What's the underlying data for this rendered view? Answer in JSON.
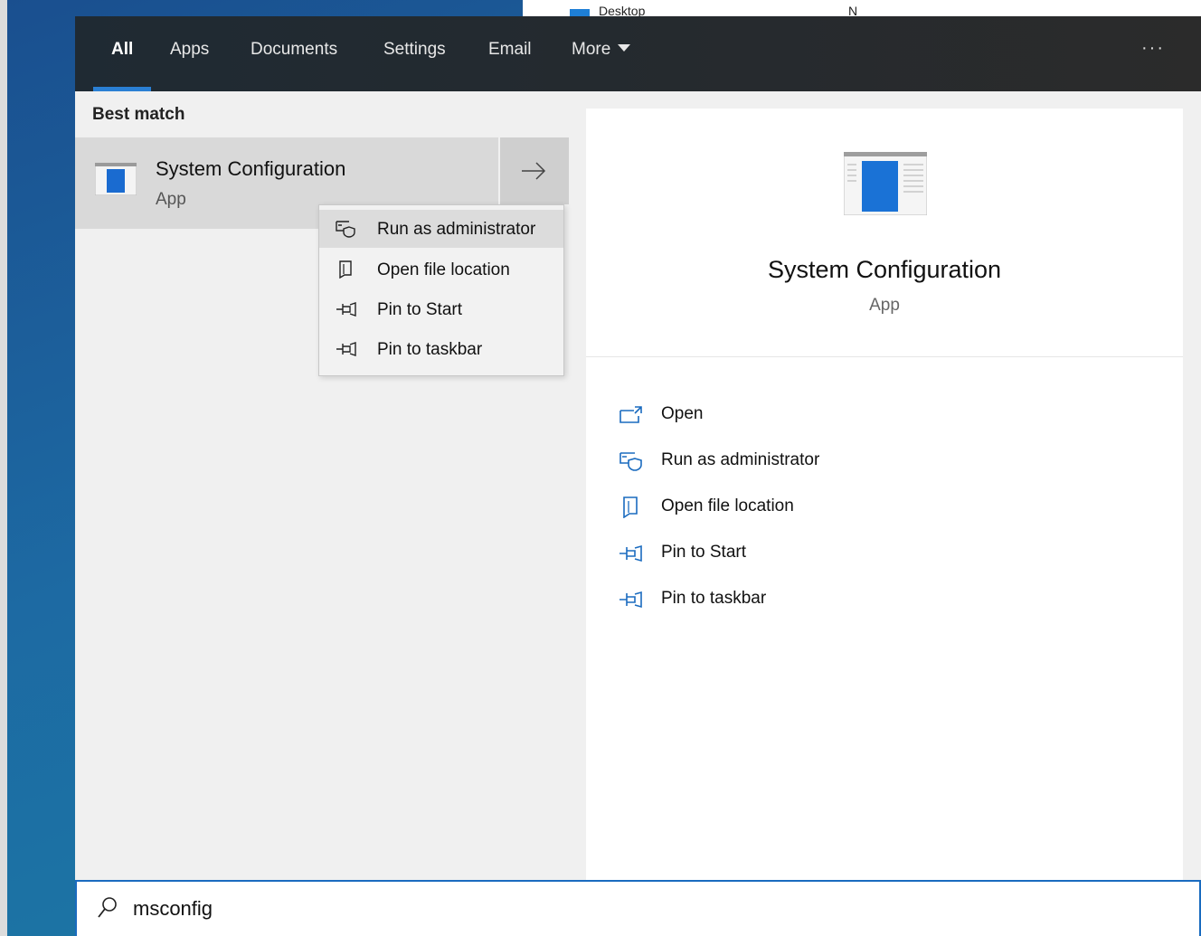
{
  "desktop": {
    "item1_label": "Desktop",
    "item2_label": "N"
  },
  "tabs": [
    {
      "label": "All",
      "active": true
    },
    {
      "label": "Apps"
    },
    {
      "label": "Documents"
    },
    {
      "label": "Settings"
    },
    {
      "label": "Email"
    },
    {
      "label": "More"
    }
  ],
  "more_options_label": "···",
  "best_match": {
    "heading": "Best match",
    "title": "System Configuration",
    "subtitle": "App"
  },
  "context_menu": [
    {
      "label": "Run as administrator",
      "icon": "shield-run-icon"
    },
    {
      "label": "Open file location",
      "icon": "file-location-icon"
    },
    {
      "label": "Pin to Start",
      "icon": "pin-icon"
    },
    {
      "label": "Pin to taskbar",
      "icon": "pin-icon"
    }
  ],
  "detail": {
    "title": "System Configuration",
    "subtitle": "App",
    "actions": [
      {
        "label": "Open",
        "icon": "open-icon"
      },
      {
        "label": "Run as administrator",
        "icon": "shield-run-icon"
      },
      {
        "label": "Open file location",
        "icon": "file-location-icon"
      },
      {
        "label": "Pin to Start",
        "icon": "pin-icon"
      },
      {
        "label": "Pin to taskbar",
        "icon": "pin-icon"
      }
    ]
  },
  "search": {
    "query": "msconfig"
  },
  "colors": {
    "accent": "#2a7fd4",
    "icon_blue": "#1a6bbf"
  }
}
